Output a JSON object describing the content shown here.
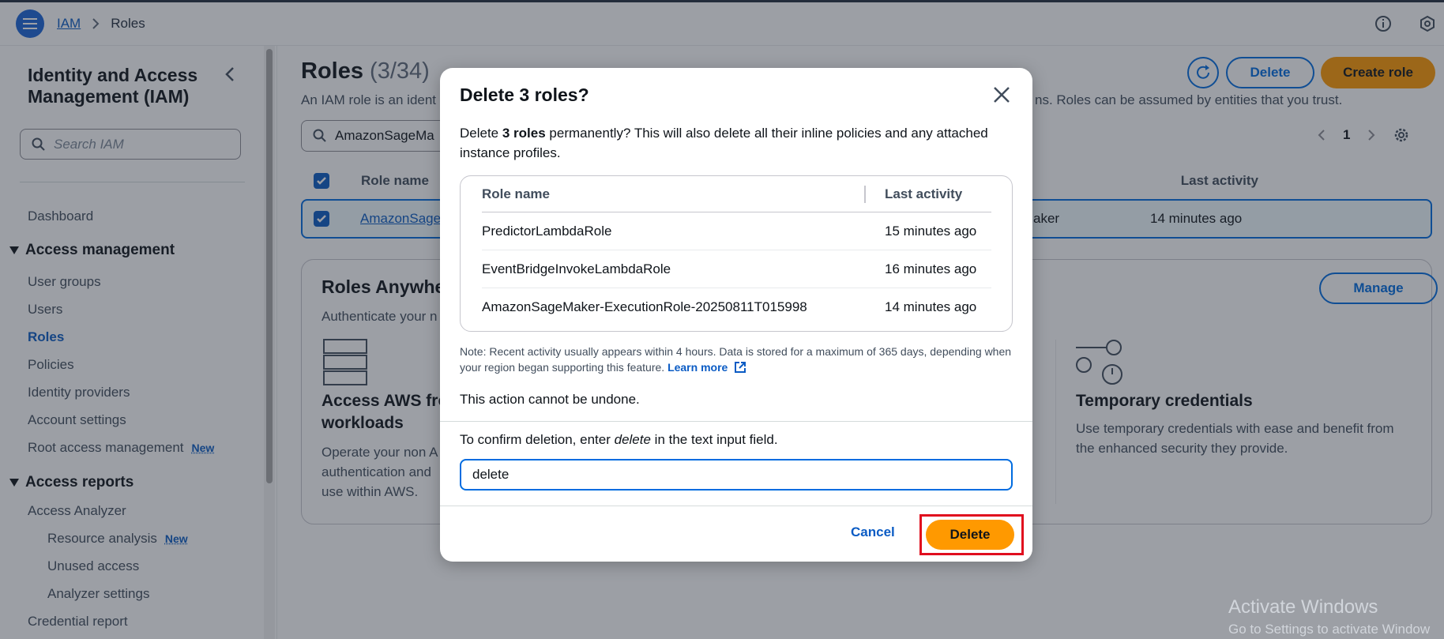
{
  "header": {
    "breadcrumb": [
      "IAM",
      "Roles"
    ]
  },
  "sidebar": {
    "title": "Identity and Access Management (IAM)",
    "search_placeholder": "Search IAM",
    "dashboard": "Dashboard",
    "section_access_management": "Access management",
    "items": [
      "User groups",
      "Users",
      "Roles",
      "Policies",
      "Identity providers",
      "Account settings",
      "Root access management"
    ],
    "section_access_reports": "Access reports",
    "access_analyzer": "Access Analyzer",
    "analyzer_items": [
      "Resource analysis",
      "Unused access",
      "Analyzer settings"
    ],
    "credential_report": "Credential report",
    "new_badge": "New"
  },
  "main": {
    "title": "Roles",
    "count": "(3/34)",
    "description_start": "An IAM role is an ident",
    "description_end": "ns. Roles can be assumed by entities that you trust.",
    "delete_label": "Delete",
    "create_role_label": "Create role",
    "filter_value": "AmazonSageMa",
    "page_number": "1",
    "col_role_name": "Role name",
    "col_last_activity": "Last activity",
    "row_role_name": "AmazonSage",
    "row_trusted": "aker",
    "row_last_activity": "14 minutes ago",
    "card_title": "Roles Anywhe",
    "card_subtitle": "Authenticate your n",
    "manage_label": "Manage",
    "feature1_title": "Access AWS fro\nworkloads",
    "feature1_desc": "Operate your non A\nauthentication and\nuse within AWS.",
    "feature2_title": "Temporary credentials",
    "feature2_desc": "Use temporary credentials with ease and benefit from the enhanced security they provide."
  },
  "modal": {
    "title": "Delete 3 roles?",
    "body_prefix": "Delete ",
    "body_bold": "3 roles",
    "body_suffix": " permanently? This will also delete all their inline policies and any attached instance profiles.",
    "col_role_name": "Role name",
    "col_last_activity": "Last activity",
    "rows": [
      {
        "name": "PredictorLambdaRole",
        "activity": "15 minutes ago"
      },
      {
        "name": "EventBridgeInvokeLambdaRole",
        "activity": "16 minutes ago"
      },
      {
        "name": "AmazonSageMaker-ExecutionRole-20250811T015998",
        "activity": "14 minutes ago"
      }
    ],
    "note": "Note: Recent activity usually appears within 4 hours. Data is stored for a maximum of 365 days, depending when your region began supporting this feature. ",
    "learn_more": "Learn more",
    "cannot_undo": "This action cannot be undone.",
    "confirm_prefix": "To confirm deletion, enter ",
    "confirm_word": "delete",
    "confirm_suffix": " in the text input field.",
    "input_value": "delete",
    "cancel_label": "Cancel",
    "delete_label": "Delete"
  },
  "watermark": {
    "line1": "Activate Windows",
    "line2": "Go to Settings to activate Window"
  },
  "colors": {
    "primary": "#ff9900",
    "link": "#0a5bc4",
    "highlight": "#e00e1e"
  }
}
